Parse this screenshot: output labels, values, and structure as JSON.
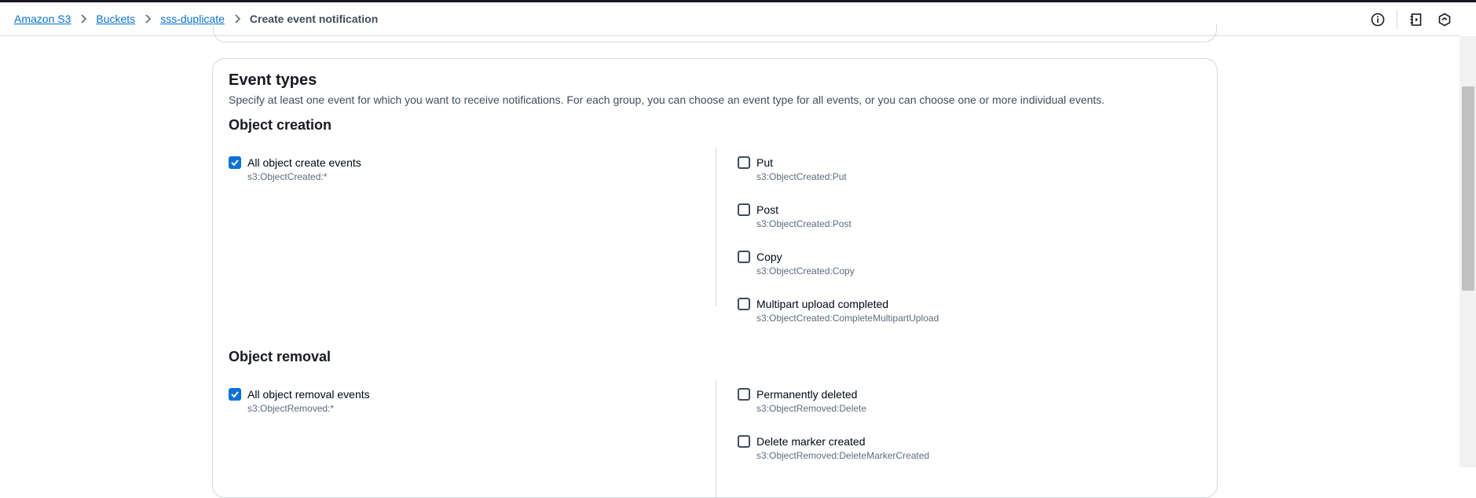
{
  "breadcrumb": {
    "items": [
      "Amazon S3",
      "Buckets",
      "sss-duplicate"
    ],
    "current": "Create event notification"
  },
  "header_icons": [
    "info-icon",
    "notebook-icon",
    "settings-hex-icon"
  ],
  "event_types": {
    "title": "Event types",
    "description": "Specify at least one event for which you want to receive notifications. For each group, you can choose an event type for all events, or you can choose one or more individual events.",
    "groups": [
      {
        "title": "Object creation",
        "all": {
          "label": "All object create events",
          "event": "s3:ObjectCreated:*",
          "checked": true
        },
        "items": [
          {
            "label": "Put",
            "event": "s3:ObjectCreated:Put",
            "checked": false
          },
          {
            "label": "Post",
            "event": "s3:ObjectCreated:Post",
            "checked": false
          },
          {
            "label": "Copy",
            "event": "s3:ObjectCreated:Copy",
            "checked": false
          },
          {
            "label": "Multipart upload completed",
            "event": "s3:ObjectCreated:CompleteMultipartUpload",
            "checked": false
          }
        ]
      },
      {
        "title": "Object removal",
        "all": {
          "label": "All object removal events",
          "event": "s3:ObjectRemoved:*",
          "checked": true
        },
        "items": [
          {
            "label": "Permanently deleted",
            "event": "s3:ObjectRemoved:Delete",
            "checked": false
          },
          {
            "label": "Delete marker created",
            "event": "s3:ObjectRemoved:DeleteMarkerCreated",
            "checked": false
          }
        ]
      }
    ]
  },
  "colors": {
    "link": "#0972d3",
    "checkbox_checked": "#0972d3",
    "border": "#d5dbdb"
  }
}
